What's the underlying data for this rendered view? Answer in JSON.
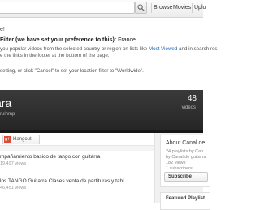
{
  "header": {
    "search_placeholder": "",
    "nav": [
      "Browse",
      "Movies",
      "Uplo"
    ],
    "icons": [
      "search-icon"
    ]
  },
  "notice": {
    "title": "e!",
    "heading_bold": "Filter (we have set your preference to this):",
    "heading_value": "France",
    "lines": [
      {
        "text": "you popular videos from the selected country or region on lists like",
        "link": "Most Viewed",
        "after": "and in search res"
      },
      {
        "text": "e the links in the footer at the bottom of the page.",
        "link": "",
        "after": ""
      },
      {
        "text": "",
        "link": "",
        "after": ""
      },
      {
        "text": "setting, or click \"Cancel\" to set your location filter to \"Worldwide\".",
        "link": "",
        "after": ""
      }
    ]
  },
  "channel": {
    "title": "ara",
    "username": "rulnmp",
    "video_count": "48",
    "video_label": "videos"
  },
  "share": {
    "hangout_label": "Hangout",
    "gplus_glyph": "g+"
  },
  "videos": [
    {
      "title": "mpañamiento basico de tango con guitarra",
      "views": "19,497 views"
    },
    {
      "title": "los TANGO Guitarra Clases venta de partituras y tabl",
      "views": "46,451 views"
    }
  ],
  "sidebar": {
    "about_title": "About Canal de",
    "lines": [
      "24 playlists by Can",
      "by Canal de guitarra",
      "182 views",
      "1 subscribers"
    ],
    "subscribe_label": "Subscribe",
    "featured_title": "Featured Playlist"
  },
  "colors": {
    "accent_link": "#1c62b9",
    "banner_bg": "#2f2f2f",
    "gplus": "#dd4b39"
  }
}
